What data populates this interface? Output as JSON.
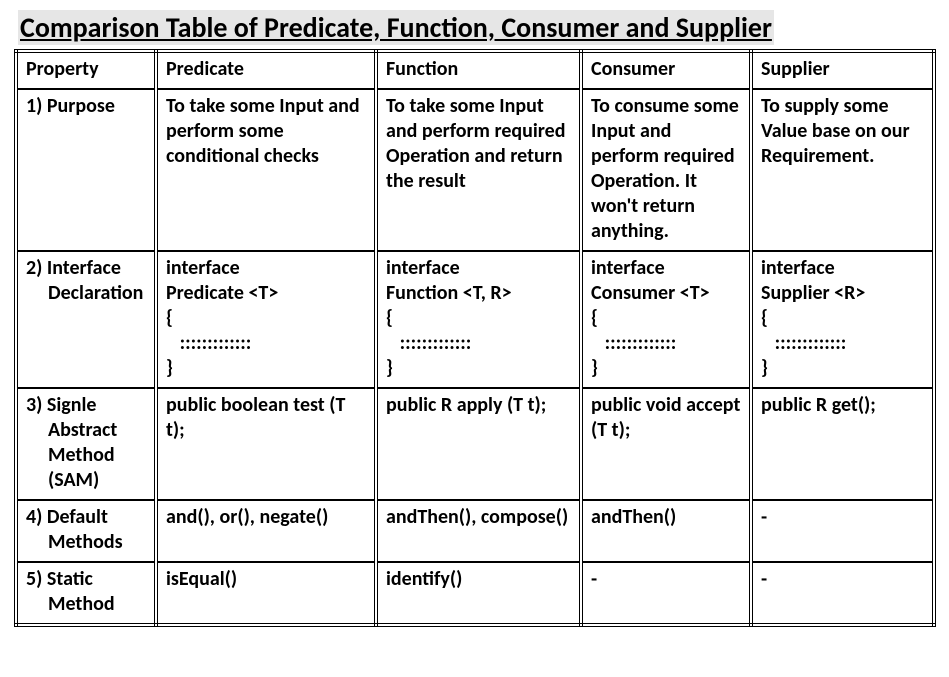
{
  "title": "Comparison Table of Predicate, Function, Consumer and Supplier",
  "headers": {
    "property": "Property",
    "predicate": "Predicate",
    "function": "Function",
    "consumer": "Consumer",
    "supplier": "Supplier"
  },
  "chart_data": {
    "type": "table",
    "columns": [
      "Property",
      "Predicate",
      "Function",
      "Consumer",
      "Supplier"
    ],
    "rows": [
      [
        "1) Purpose",
        "To take some Input and perform some conditional checks",
        "To take some Input and perform required Operation and return the result",
        "To consume some Input and perform required Operation. It won't return anything.",
        "To supply some Value base on our Requirement."
      ],
      [
        "2) Interface Declaration",
        "interface\nPredicate <T>\n{\n   :::::::::::::\n}",
        "interface\nFunction <T, R>\n{\n   :::::::::::::\n}",
        "interface\nConsumer <T>\n{\n   :::::::::::::\n}",
        "interface\nSupplier <R>\n{\n   :::::::::::::\n}"
      ],
      [
        "3) Signle Abstract Method (SAM)",
        "public boolean test (T t);",
        "public R apply (T t);",
        "public void accept (T t);",
        "public R get();"
      ],
      [
        "4) Default Methods",
        "and(), or(), negate()",
        "andThen(), compose()",
        "andThen()",
        "-"
      ],
      [
        "5) Static Method",
        "isEqual()",
        "identify()",
        "-",
        "-"
      ]
    ]
  },
  "rows": {
    "r1": {
      "prop_l1": "1) Purpose",
      "prop_l2": "",
      "c1": "To take some Input and perform some conditional checks",
      "c2": "To take some Input and perform required Operation and return the result",
      "c3": "To consume some Input and perform required Operation. It won't return anything.",
      "c4": "To supply some Value base on our Requirement."
    },
    "r2": {
      "prop_l1": "2) Interface",
      "prop_l2": "Declaration",
      "c1": "interface\nPredicate <T>\n{\n   :::::::::::::\n}",
      "c2": "interface\nFunction <T, R>\n{\n   :::::::::::::\n}",
      "c3": "interface\nConsumer <T>\n{\n   :::::::::::::\n}",
      "c4": "interface\nSupplier <R>\n{\n   :::::::::::::\n}"
    },
    "r3": {
      "prop_l1": "3) Signle",
      "prop_l2": "Abstract\nMethod\n(SAM)",
      "c1": "public boolean test (T t);",
      "c2": "public R apply (T t);",
      "c3": "public void accept (T t);",
      "c4": "public R get();"
    },
    "r4": {
      "prop_l1": "4) Default",
      "prop_l2": "Methods",
      "c1": "and(), or(), negate()",
      "c2": "andThen(), compose()",
      "c3": "andThen()",
      "c4": "-"
    },
    "r5": {
      "prop_l1": "5) Static",
      "prop_l2": "Method",
      "c1": "isEqual()",
      "c2": "identify()",
      "c3": "-",
      "c4": "-"
    }
  }
}
